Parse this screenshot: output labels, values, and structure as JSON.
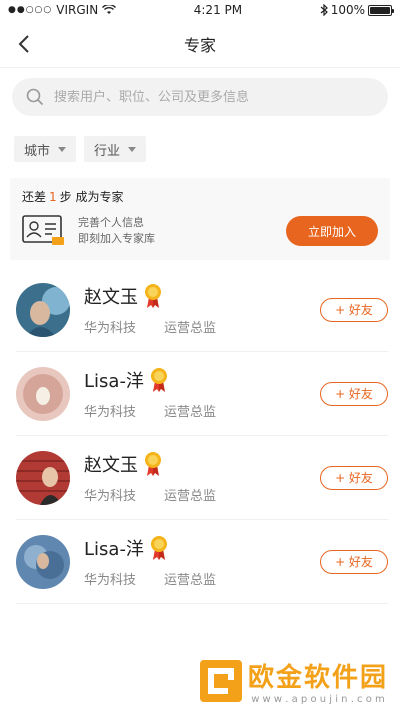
{
  "status": {
    "carrier": "VIRGIN",
    "time": "4:21 PM",
    "battery_text": "100%",
    "battery_level": 1.0
  },
  "nav": {
    "title": "专家",
    "back_icon": "chevron-left-icon"
  },
  "search": {
    "placeholder": "搜索用户、职位、公司及更多信息"
  },
  "filters": [
    {
      "label": "城市"
    },
    {
      "label": "行业"
    }
  ],
  "promo": {
    "title_prefix": "还差",
    "title_num": "1",
    "title_suffix": "步 成为专家",
    "line1": "完善个人信息",
    "line2": "即刻加入专家库",
    "button": "立即加入"
  },
  "experts": [
    {
      "name": "赵文玉",
      "company": "华为科技",
      "title": "运营总监",
      "button": "+ 好友"
    },
    {
      "name": "Lisa-洋",
      "company": "华为科技",
      "title": "运营总监",
      "button": "+ 好友"
    },
    {
      "name": "赵文玉",
      "company": "华为科技",
      "title": "运营总监",
      "button": "+ 好友"
    },
    {
      "name": "Lisa-洋",
      "company": "华为科技",
      "title": "运营总监",
      "button": "+ 好友"
    }
  ],
  "watermark": {
    "text": "欧金软件园",
    "url": "w w w . a p o u j i n . c o m"
  },
  "colors": {
    "accent": "#e8651f",
    "watermark": "#f4a11a"
  }
}
